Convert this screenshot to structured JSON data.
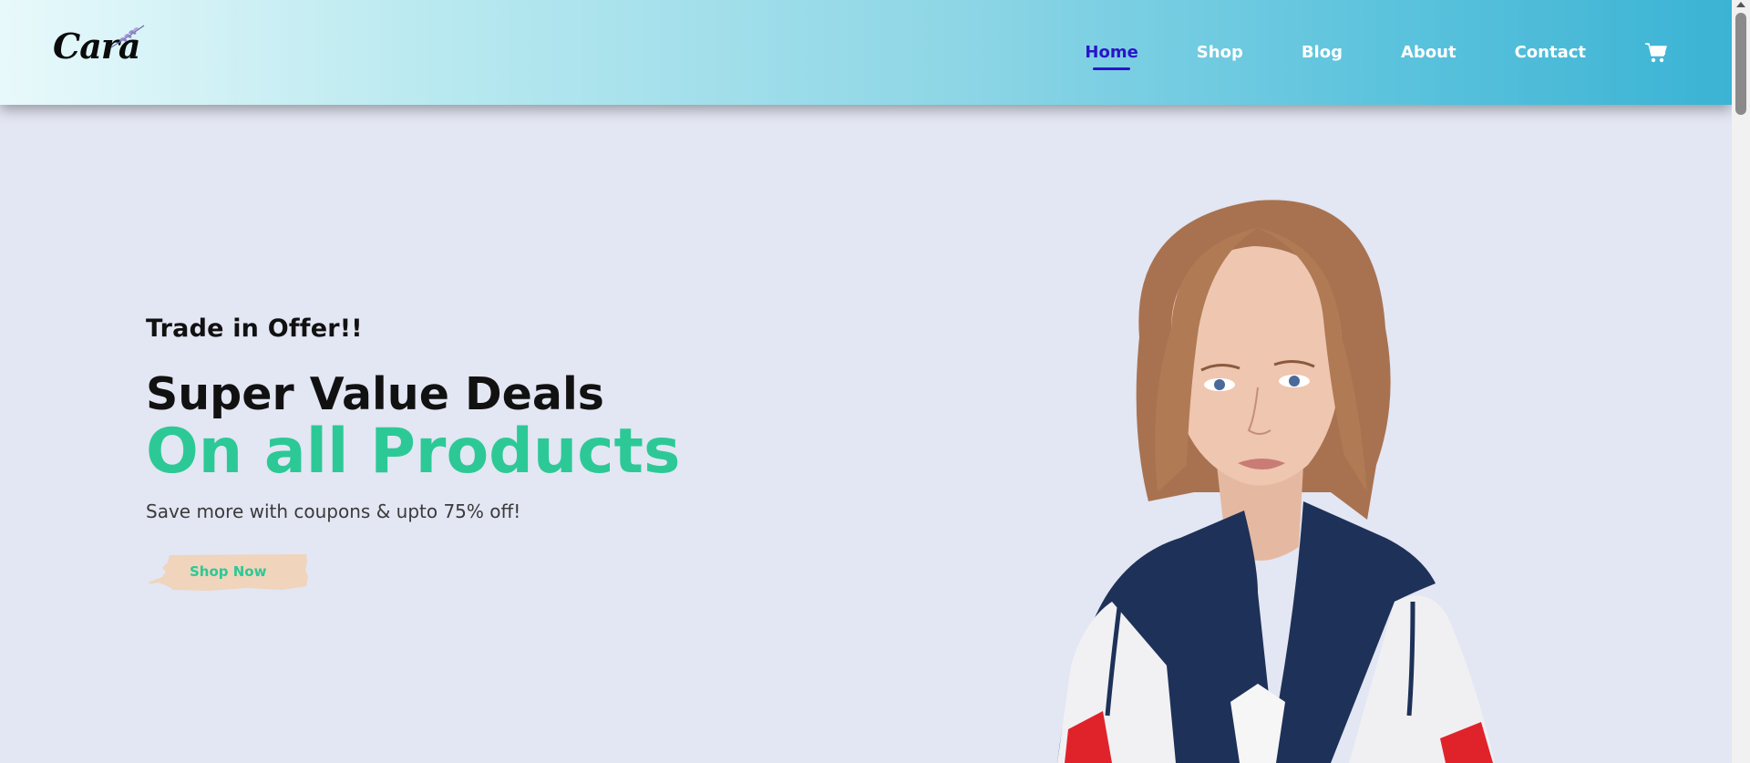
{
  "header": {
    "logo_text": "Cara",
    "nav": [
      {
        "label": "Home",
        "active": true
      },
      {
        "label": "Shop",
        "active": false
      },
      {
        "label": "Blog",
        "active": false
      },
      {
        "label": "About",
        "active": false
      },
      {
        "label": "Contact",
        "active": false
      }
    ],
    "cart_icon": "shopping-cart-icon"
  },
  "hero": {
    "subtitle": "Trade in Offer!!",
    "title": "Super Value Deals",
    "accent": "On all Products",
    "description": "Save more with coupons & upto 75% off!",
    "button_label": "Shop Now"
  },
  "colors": {
    "accent_green": "#2cc996",
    "active_nav": "#2a14c8",
    "page_bg": "#e3e6f3",
    "button_bg": "#f2d3b8"
  }
}
